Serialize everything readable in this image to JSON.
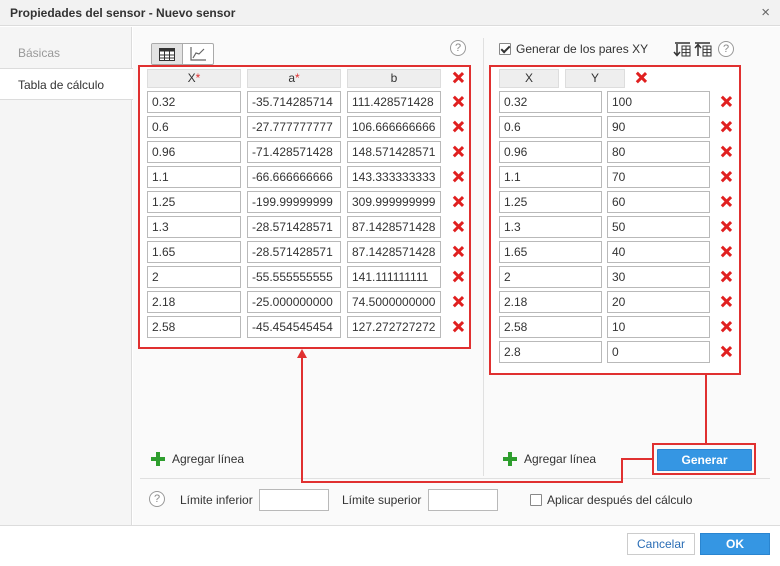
{
  "dialog": {
    "title": "Propiedades del sensor - Nuevo sensor",
    "close_glyph": "×"
  },
  "sidebar": {
    "items": [
      {
        "label": "Básicas"
      },
      {
        "label": "Tabla de cálculo"
      }
    ]
  },
  "help_glyph": "?",
  "left_table": {
    "headers": [
      {
        "label": "X",
        "required": "*"
      },
      {
        "label": "a",
        "required": "*"
      },
      {
        "label": "b",
        "required": ""
      }
    ],
    "rows": [
      [
        "0.32",
        "-35.714285714",
        "111.428571428"
      ],
      [
        "0.6",
        "-27.777777777",
        "106.666666666"
      ],
      [
        "0.96",
        "-71.428571428",
        "148.571428571"
      ],
      [
        "1.1",
        "-66.666666666",
        "143.333333333"
      ],
      [
        "1.25",
        "-199.99999999",
        "309.999999999"
      ],
      [
        "1.3",
        "-28.571428571",
        "87.1428571428"
      ],
      [
        "1.65",
        "-28.571428571",
        "87.1428571428"
      ],
      [
        "2",
        "-55.555555555",
        "141.111111111"
      ],
      [
        "2.18",
        "-25.000000000",
        "74.5000000000"
      ],
      [
        "2.58",
        "-45.454545454",
        "127.272727272"
      ]
    ],
    "add_line": "Agregar línea"
  },
  "right_panel": {
    "generate_checkbox_label": "Generar de los pares XY",
    "headers": [
      "X",
      "Y"
    ],
    "rows": [
      [
        "0.32",
        "100"
      ],
      [
        "0.6",
        "90"
      ],
      [
        "0.96",
        "80"
      ],
      [
        "1.1",
        "70"
      ],
      [
        "1.25",
        "60"
      ],
      [
        "1.3",
        "50"
      ],
      [
        "1.65",
        "40"
      ],
      [
        "2",
        "30"
      ],
      [
        "2.18",
        "20"
      ],
      [
        "2.58",
        "10"
      ],
      [
        "2.8",
        "0"
      ]
    ],
    "add_line": "Agregar línea",
    "generate_button": "Generar"
  },
  "limits": {
    "lower_label": "Límite inferior",
    "lower_value": "",
    "upper_label": "Límite superior",
    "upper_value": "",
    "apply_after_label": "Aplicar después del cálculo"
  },
  "footer": {
    "cancel": "Cancelar",
    "ok": "OK"
  },
  "colors": {
    "accent": "#3596e3",
    "highlight": "#e03030",
    "delete": "#e02020",
    "add": "#2e9e2e"
  }
}
